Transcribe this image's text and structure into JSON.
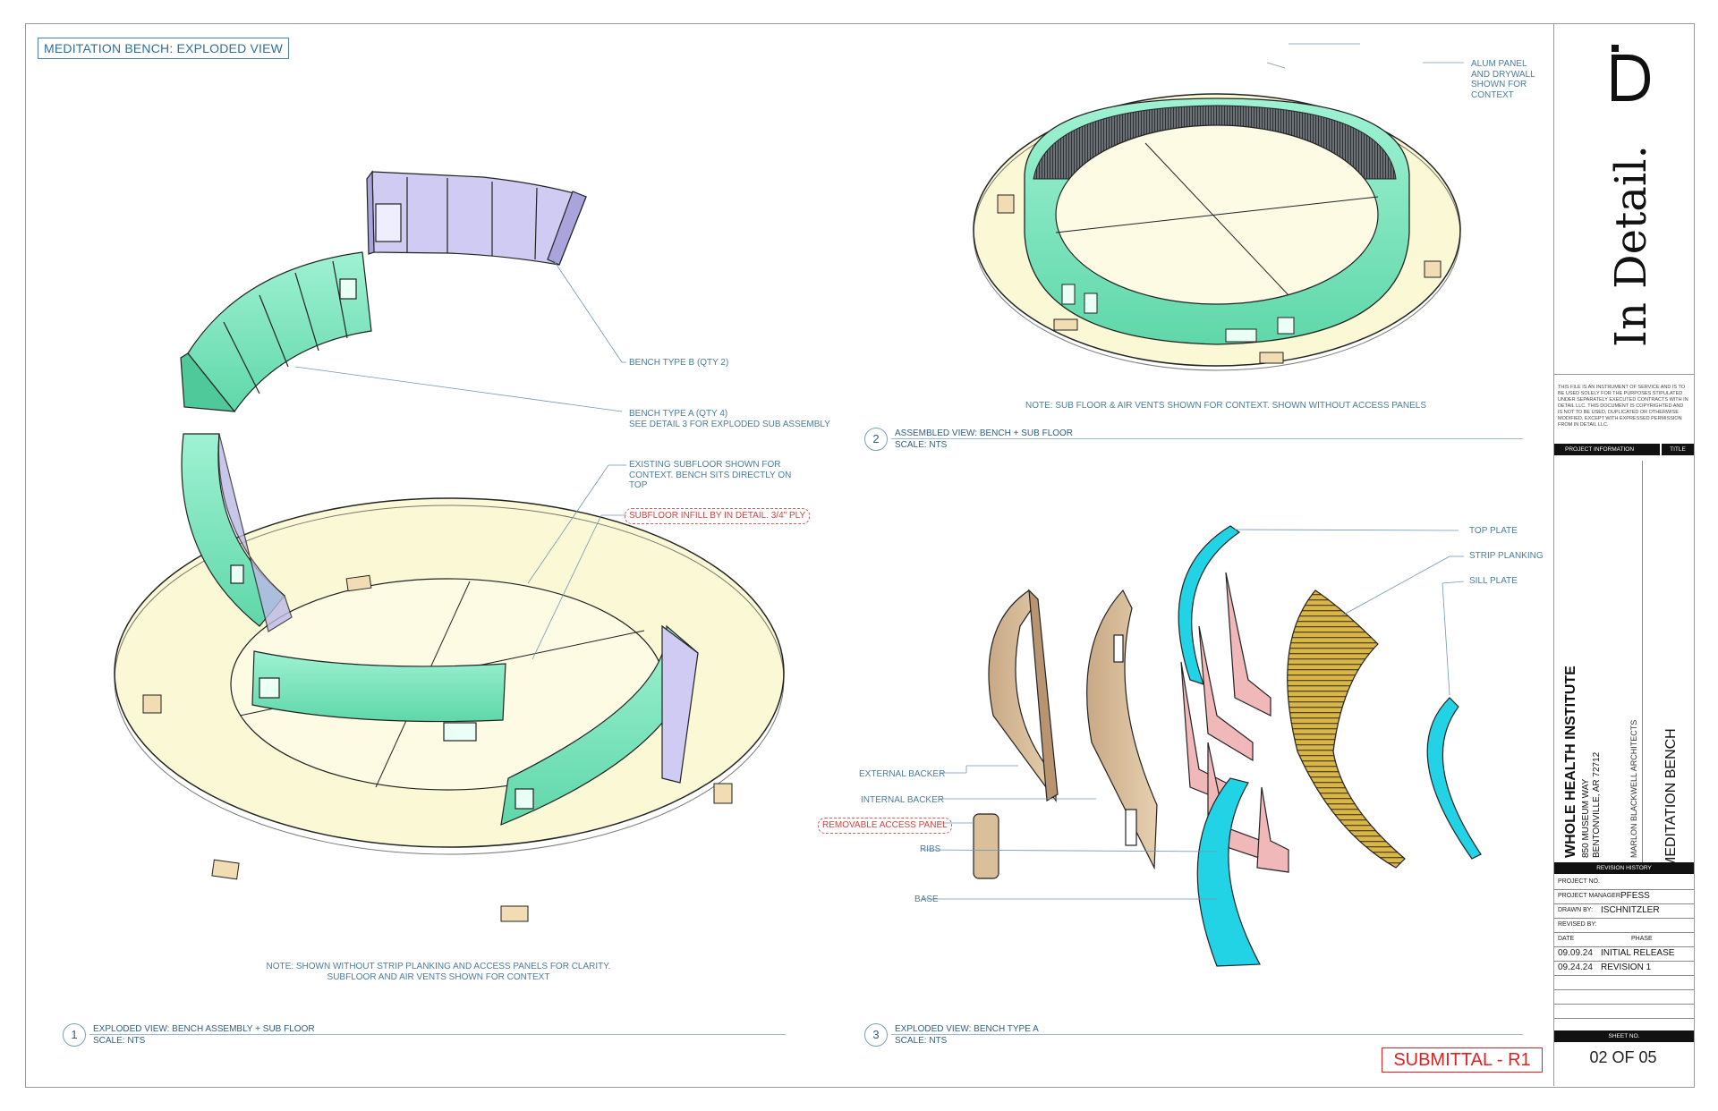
{
  "sheet": {
    "title": "MEDITATION BENCH: EXPLODED VIEW",
    "submittal": "SUBMITTAL - R1",
    "sheet_number": "02 OF 05"
  },
  "view1": {
    "number": "1",
    "title": "EXPLODED VIEW: BENCH ASSEMBLY + SUB FLOOR",
    "scale": "SCALE: NTS",
    "note_line1": "NOTE: SHOWN WITHOUT STRIP PLANKING AND ACCESS PANELS FOR CLARITY.",
    "note_line2": "SUBFLOOR AND AIR VENTS SHOWN FOR CONTEXT",
    "callouts": {
      "bench_b": "BENCH TYPE B (QTY 2)",
      "bench_a_1": "BENCH TYPE A (QTY 4)",
      "bench_a_2": "SEE DETAIL 3 FOR EXPLODED SUB ASSEMBLY",
      "subfloor_1": "EXISTING SUBFLOOR SHOWN FOR",
      "subfloor_2": "CONTEXT. BENCH SITS DIRECTLY ON",
      "subfloor_3": "TOP",
      "infill": "SUBFLOOR INFILL BY IN DETAIL. 3/4\" PLY"
    }
  },
  "view2": {
    "number": "2",
    "title": "ASSEMBLED VIEW: BENCH + SUB FLOOR",
    "scale": "SCALE: NTS",
    "note": "NOTE: SUB FLOOR & AIR VENTS SHOWN FOR CONTEXT. SHOWN WITHOUT ACCESS PANELS",
    "callouts": {
      "alum_1": "ALUM PANEL",
      "alum_2": "AND DRYWALL",
      "alum_3": "SHOWN FOR",
      "alum_4": "CONTEXT"
    }
  },
  "view3": {
    "number": "3",
    "title": "EXPLODED VIEW: BENCH TYPE A",
    "scale": "SCALE: NTS",
    "callouts": {
      "top_plate": "TOP PLATE",
      "strip_planking": "STRIP PLANKING",
      "sill_plate": "SILL PLATE",
      "external_backer": "EXTERNAL BACKER",
      "internal_backer": "INTERNAL BACKER",
      "access_panel": "REMOVABLE ACCESS PANEL",
      "ribs": "RIBS",
      "base": "BASE"
    }
  },
  "title_block": {
    "logo_text": "In Detail.",
    "disclaimer": "THIS FILE IS AN INSTRUMENT OF SERVICE AND IS TO BE USED SOLELY FOR THE PURPOSES STIPULATED UNDER SEPARATELY EXECUTED CONTRACTS WITH IN DETAIL LLC. THIS DOCUMENT IS COPYRIGHTED AND IS NOT TO BE USED, DUPLICATED OR OTHERWISE MODIFIED, EXCEPT WITH EXPRESSED PERMISSION FROM IN DETAIL LLC.",
    "project_info_label": "PROJECT INFORMATION",
    "title_label": "TITLE",
    "project_name": "WHOLE HEALTH INSTITUTE",
    "address_1": "850 MUSEUM WAY",
    "address_2": "BENTONVILLE, AR 72712",
    "architect": "MARLON BLACKWELL ARCHITECTS",
    "sheet_title": "MEDITATION BENCH",
    "revision_history_label": "REVISION HISTORY",
    "project_no_label": "PROJECT NO.",
    "project_manager_label": "PROJECT MANAGER:",
    "project_manager": "PFESS",
    "drawn_by_label": "DRAWN BY:",
    "drawn_by": "ISCHNITZLER",
    "revised_by_label": "REVISED BY:",
    "date_label": "DATE",
    "phase_label": "PHASE",
    "revisions": [
      {
        "date": "09.09.24",
        "phase": "INITIAL RELEASE"
      },
      {
        "date": "09.24.24",
        "phase": "REVISION 1"
      }
    ],
    "sheet_no_label": "SHEET NO."
  },
  "colors": {
    "bench_green": "#7fe8bf",
    "bench_lavender": "#c9c6ef",
    "subfloor": "#fbf8d6",
    "plywood": "#d9bf9a",
    "cyan_plate": "#22d3e6",
    "ribs_pink": "#f0b8b8",
    "planking": "#c9a33a",
    "label_blue": "#4b7d99",
    "red_markup": "#d22222"
  }
}
